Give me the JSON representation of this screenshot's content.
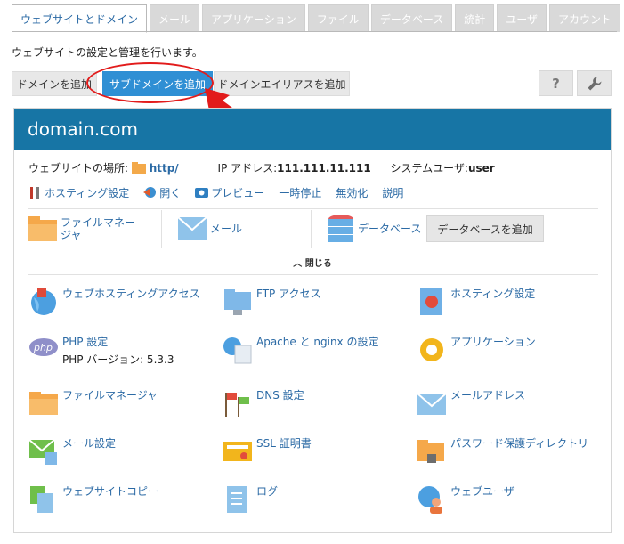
{
  "tabs": [
    "ウェブサイトとドメイン",
    "メール",
    "アプリケーション",
    "ファイル",
    "データベース",
    "統計",
    "ユーザ",
    "アカウント"
  ],
  "subtitle": "ウェブサイトの設定と管理を行います。",
  "toolbar": {
    "add_domain": "ドメインを追加",
    "add_subdomain": "サブドメインを追加",
    "add_alias": "ドメインエイリアスを追加",
    "help_icon": "?"
  },
  "domain": {
    "name": "domain.com",
    "location_label": "ウェブサイトの場所:",
    "location_value": "http/",
    "ip_label": "IP アドレス:",
    "ip_value": "111.111.11.111",
    "sysuser_label": "システムユーザ:",
    "sysuser_value": "user"
  },
  "actions": [
    "ホスティング設定",
    "開く",
    "プレビュー",
    "一時停止",
    "無効化",
    "説明"
  ],
  "quick": {
    "filemanager_line1": "ファイルマネー",
    "filemanager_line2": "ジャ",
    "mail": "メール",
    "database": "データベース",
    "add_database": "データベースを追加"
  },
  "close_label": "閉じる",
  "items": [
    {
      "label": "ウェブホスティングアクセス",
      "icon": "globe-lock-icon"
    },
    {
      "label": "FTP アクセス",
      "icon": "ftp-folder-icon"
    },
    {
      "label": "ホスティング設定",
      "icon": "hosting-settings-icon"
    },
    {
      "label": "PHP 設定",
      "sub": "PHP バージョン: 5.3.3",
      "icon": "php-icon"
    },
    {
      "label": "Apache と nginx の設定",
      "icon": "apache-nginx-icon"
    },
    {
      "label": "アプリケーション",
      "icon": "gear-icon"
    },
    {
      "label": "ファイルマネージャ",
      "icon": "folder-icon"
    },
    {
      "label": "DNS 設定",
      "icon": "dns-flags-icon"
    },
    {
      "label": "メールアドレス",
      "icon": "envelope-icon"
    },
    {
      "label": "メール設定",
      "icon": "mail-settings-icon"
    },
    {
      "label": "SSL 証明書",
      "icon": "certificate-icon"
    },
    {
      "label": "パスワード保護ディレクトリ",
      "icon": "locked-folder-icon"
    },
    {
      "label": "ウェブサイトコピー",
      "icon": "copy-icon"
    },
    {
      "label": "ログ",
      "icon": "log-icon"
    },
    {
      "label": "ウェブユーザ",
      "icon": "web-user-icon"
    }
  ],
  "colors": {
    "header_blue": "#1775a5",
    "link_blue": "#2b6aa5",
    "button_blue": "#2f8fd4",
    "highlight_red": "#e21b1b"
  }
}
